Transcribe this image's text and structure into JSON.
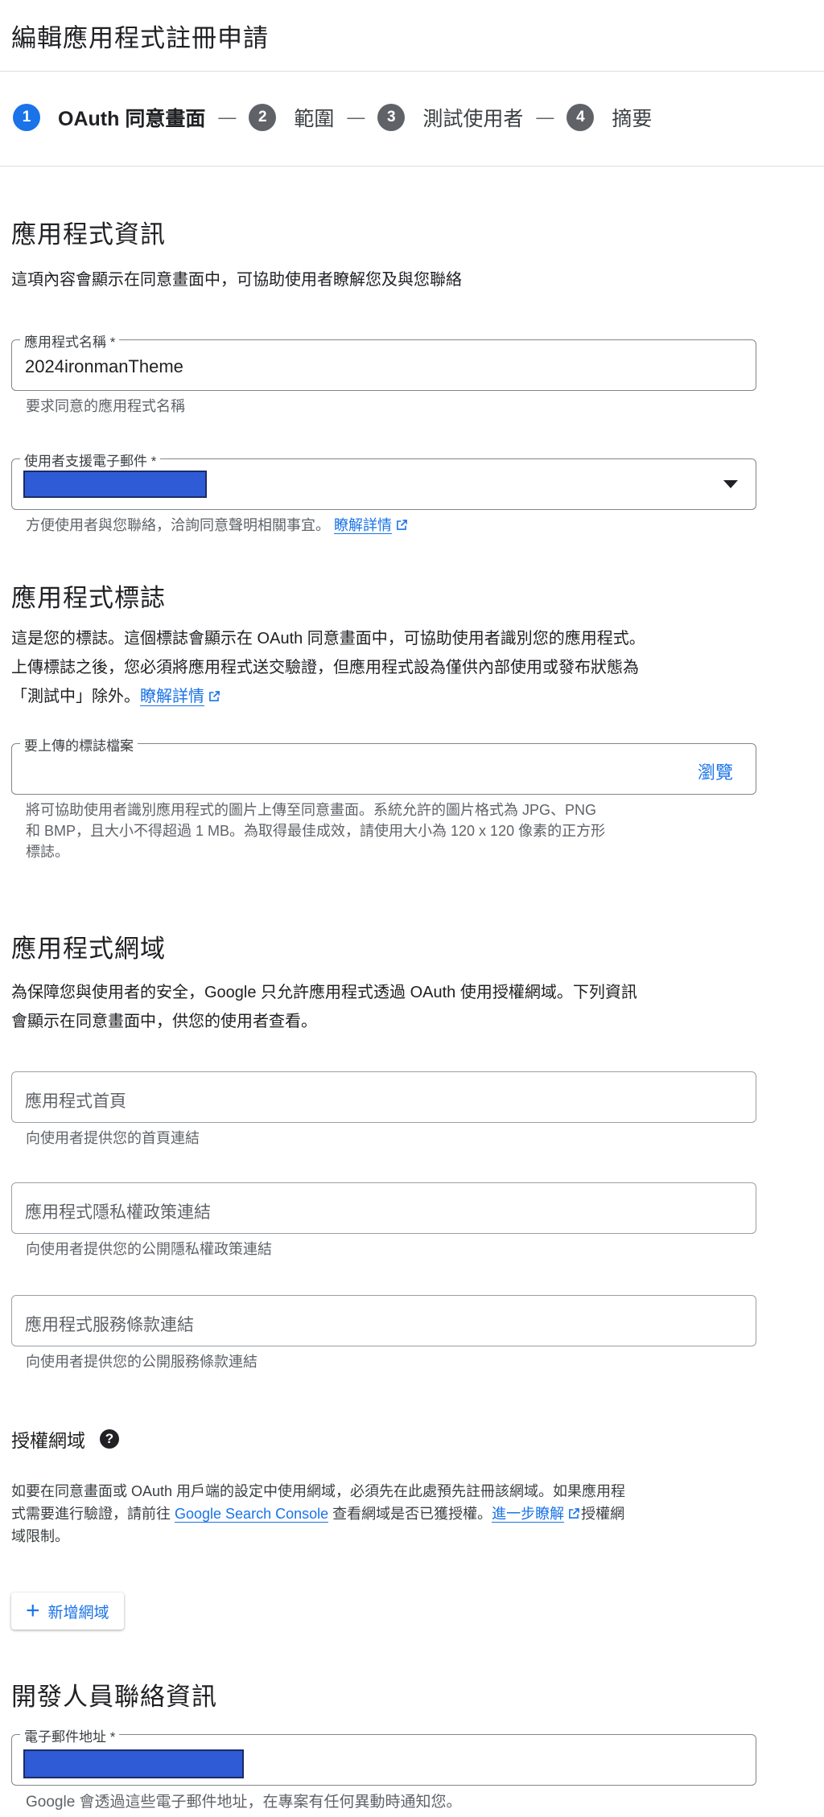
{
  "page": {
    "title": "編輯應用程式註冊申請"
  },
  "stepper": [
    {
      "num": "1",
      "label": "OAuth 同意畫面"
    },
    {
      "num": "2",
      "label": "範圍"
    },
    {
      "num": "3",
      "label": "測試使用者"
    },
    {
      "num": "4",
      "label": "摘要"
    }
  ],
  "stepper_separator": "—",
  "app_info": {
    "title": "應用程式資訊",
    "description": "這項內容會顯示在同意畫面中，可協助使用者瞭解您及與您聯絡",
    "app_name": {
      "label": "應用程式名稱 *",
      "value": "2024ironmanTheme",
      "hint": "要求同意的應用程式名稱"
    },
    "support_email": {
      "label": "使用者支援電子郵件 *",
      "hint": "方便使用者與您聯絡，洽詢同意聲明相關事宜。",
      "link": "瞭解詳情"
    }
  },
  "logo": {
    "title": "應用程式標誌",
    "description_line1": "這是您的標誌。這個標誌會顯示在 OAuth 同意畫面中，可協助使用者識別您的應用程式。",
    "description_line2": "上傳標誌之後，您必須將應用程式送交驗證，但應用程式設為僅供內部使用或發布狀態為",
    "description_line3": "「測試中」除外。",
    "link": "瞭解詳情",
    "upload": {
      "label": "要上傳的標誌檔案",
      "browse": "瀏覽"
    },
    "hint_line1": "將可協助使用者識別應用程式的圖片上傳至同意畫面。系統允許的圖片格式為 JPG、PNG",
    "hint_line2": "和 BMP，且大小不得超過 1 MB。為取得最佳成效，請使用大小為 120 x 120 像素的正方形",
    "hint_line3": "標誌。"
  },
  "domain": {
    "title": "應用程式網域",
    "description_line1": "為保障您與使用者的安全，Google 只允許應用程式透過 OAuth 使用授權網域。下列資訊",
    "description_line2": "會顯示在同意畫面中，供您的使用者查看。",
    "homepage": {
      "placeholder": "應用程式首頁",
      "hint": "向使用者提供您的首頁連結"
    },
    "privacy": {
      "placeholder": "應用程式隱私權政策連結",
      "hint": "向使用者提供您的公開隱私權政策連結"
    },
    "terms": {
      "placeholder": "應用程式服務條款連結",
      "hint": "向使用者提供您的公開服務條款連結"
    }
  },
  "authorized_domains": {
    "title": "授權網域",
    "help_icon": "?",
    "text_part1": "如要在同意畫面或 OAuth 用戶端的設定中使用網域，必須先在此處預先註冊該網域。如果應用程",
    "text_part2": "式需要進行驗證，請前往 ",
    "link_console": "Google Search Console",
    "text_part3": " 查看網域是否已獲授權。",
    "link_more": "進一步瞭解",
    "text_part4": "授權網",
    "text_part5": "域限制。",
    "add_button": "新增網域",
    "add_icon": "+"
  },
  "developer": {
    "title": "開發人員聯絡資訊",
    "email": {
      "label": "電子郵件地址 *",
      "hint": "Google 會透過這些電子郵件地址，在專案有任何異動時通知您。"
    }
  },
  "colors": {
    "accent": "#1a73e8",
    "redact": "#2f5bd6",
    "step_inactive": "#5f6368"
  }
}
